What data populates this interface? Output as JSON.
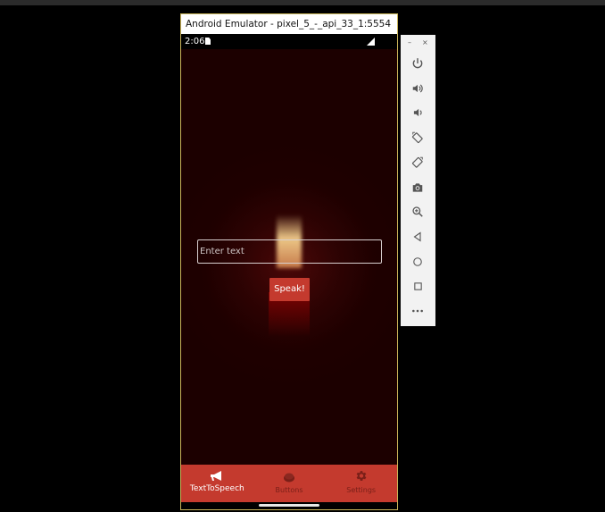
{
  "window": {
    "title": "Android Emulator - pixel_5_-_api_33_1:5554"
  },
  "status_bar": {
    "time": "2:06",
    "sim_icon": "sim-card-icon",
    "signal_icon": "signal-icon"
  },
  "main": {
    "input_placeholder": "Enter text",
    "speak_label": "Speak!"
  },
  "bottom_nav": {
    "items": [
      {
        "label": "TextToSpeech",
        "icon": "megaphone-icon",
        "active": true
      },
      {
        "label": "Buttons",
        "icon": "button-icon",
        "active": false
      },
      {
        "label": "Settings",
        "icon": "gear-icon",
        "active": false
      }
    ]
  },
  "side_toolbar": {
    "minimize_label": "–",
    "close_label": "×",
    "buttons": [
      "power-icon",
      "volume-up-icon",
      "volume-down-icon",
      "rotate-left-icon",
      "rotate-right-icon",
      "camera-icon",
      "zoom-icon",
      "back-icon",
      "home-icon",
      "overview-icon",
      "more-icon"
    ]
  },
  "colors": {
    "accent": "#c43a2e",
    "app_background": "#1c0000",
    "window_border": "#c9b458"
  }
}
